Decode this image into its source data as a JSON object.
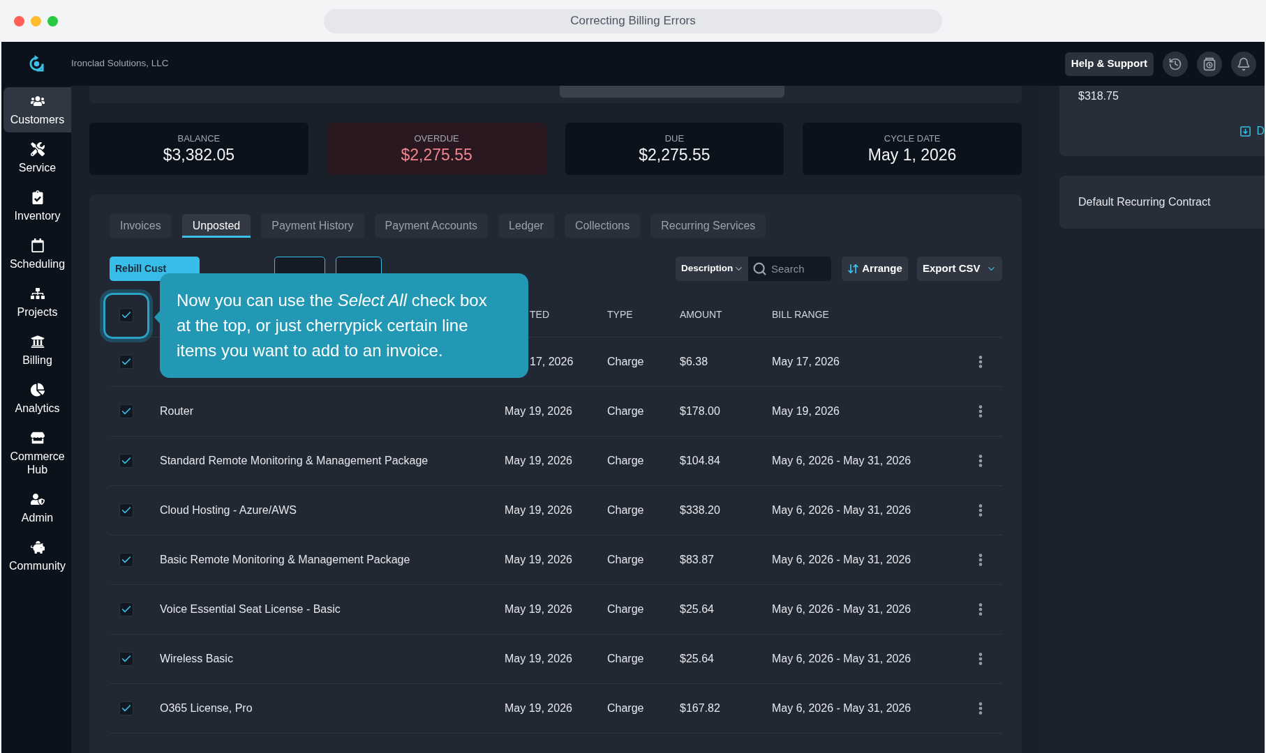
{
  "browser": {
    "title": "Correcting Billing Errors"
  },
  "header": {
    "company": "Ironclad Solutions, LLC",
    "help_button": "Help & Support"
  },
  "sidebar": {
    "items": [
      {
        "label": "Customers",
        "selected": true
      },
      {
        "label": "Service",
        "selected": false
      },
      {
        "label": "Inventory",
        "selected": false
      },
      {
        "label": "Scheduling",
        "selected": false
      },
      {
        "label": "Projects",
        "selected": false
      },
      {
        "label": "Billing",
        "selected": false
      },
      {
        "label": "Analytics",
        "selected": false
      },
      {
        "label": "Commerce Hub",
        "selected": false
      },
      {
        "label": "Admin",
        "selected": false
      },
      {
        "label": "Community",
        "selected": false
      }
    ]
  },
  "section_tabs": [
    {
      "selected": false
    },
    {
      "selected": false
    },
    {
      "selected": true
    },
    {
      "selected": false
    }
  ],
  "stats": [
    {
      "label": "BALANCE",
      "value": "$3,382.05",
      "kind": "normal"
    },
    {
      "label": "OVERDUE",
      "value": "$2,275.55",
      "kind": "alert"
    },
    {
      "label": "DUE",
      "value": "$2,275.55",
      "kind": "normal"
    },
    {
      "label": "CYCLE DATE",
      "value": "May 1, 2026",
      "kind": "normal"
    }
  ],
  "billing_tabs": [
    {
      "label": "Invoices",
      "selected": false
    },
    {
      "label": "Unposted",
      "selected": true
    },
    {
      "label": "Payment History",
      "selected": false
    },
    {
      "label": "Payment Accounts",
      "selected": false
    },
    {
      "label": "Ledger",
      "selected": false
    },
    {
      "label": "Collections",
      "selected": false
    },
    {
      "label": "Recurring Services",
      "selected": false
    }
  ],
  "toolbar": {
    "rebill_button": "Rebill Cust",
    "filter": "Description",
    "search_placeholder": "Search",
    "arrange_button": "Arrange",
    "export_button": "Export CSV"
  },
  "table": {
    "select_all_checked": true,
    "columns": [
      {
        "label": "TED"
      },
      {
        "label": "TYPE"
      },
      {
        "label": "AMOUNT"
      },
      {
        "label": "BILL RANGE"
      }
    ],
    "rows": [
      {
        "checked": true,
        "date": "17, 2026",
        "type": "Charge",
        "amount": "$6.38",
        "bill_range": "May 17, 2026"
      },
      {
        "checked": true,
        "description": "Router",
        "date": "May 19, 2026",
        "type": "Charge",
        "amount": "$178.00",
        "bill_range": "May 19, 2026"
      },
      {
        "checked": true,
        "description": "Standard Remote Monitoring & Management Package",
        "date": "May 19, 2026",
        "type": "Charge",
        "amount": "$104.84",
        "bill_range": "May 6, 2026 - May 31, 2026"
      },
      {
        "checked": true,
        "description": "Cloud Hosting - Azure/AWS",
        "date": "May 19, 2026",
        "type": "Charge",
        "amount": "$338.20",
        "bill_range": "May 6, 2026 - May 31, 2026"
      },
      {
        "checked": true,
        "description": "Basic Remote Monitoring & Management Package",
        "date": "May 19, 2026",
        "type": "Charge",
        "amount": "$83.87",
        "bill_range": "May 6, 2026 - May 31, 2026"
      },
      {
        "checked": true,
        "description": "Voice Essential Seat License - Basic",
        "date": "May 19, 2026",
        "type": "Charge",
        "amount": "$25.64",
        "bill_range": "May 6, 2026 - May 31, 2026"
      },
      {
        "checked": true,
        "description": "Wireless Basic",
        "date": "May 19, 2026",
        "type": "Charge",
        "amount": "$25.64",
        "bill_range": "May 6, 2026 - May 31, 2026"
      },
      {
        "checked": true,
        "description": "O365 License, Pro",
        "date": "May 19, 2026",
        "type": "Charge",
        "amount": "$167.82",
        "bill_range": "May 6, 2026 - May 31, 2026"
      }
    ]
  },
  "tooltip": {
    "text": "Now you can use the *Select All* check box at the top, or just cherrypick certain line items you want to add to an invoice."
  },
  "right_panel": {
    "amount": "$318.75",
    "link": "D",
    "contract": "Default Recurring Contract"
  }
}
